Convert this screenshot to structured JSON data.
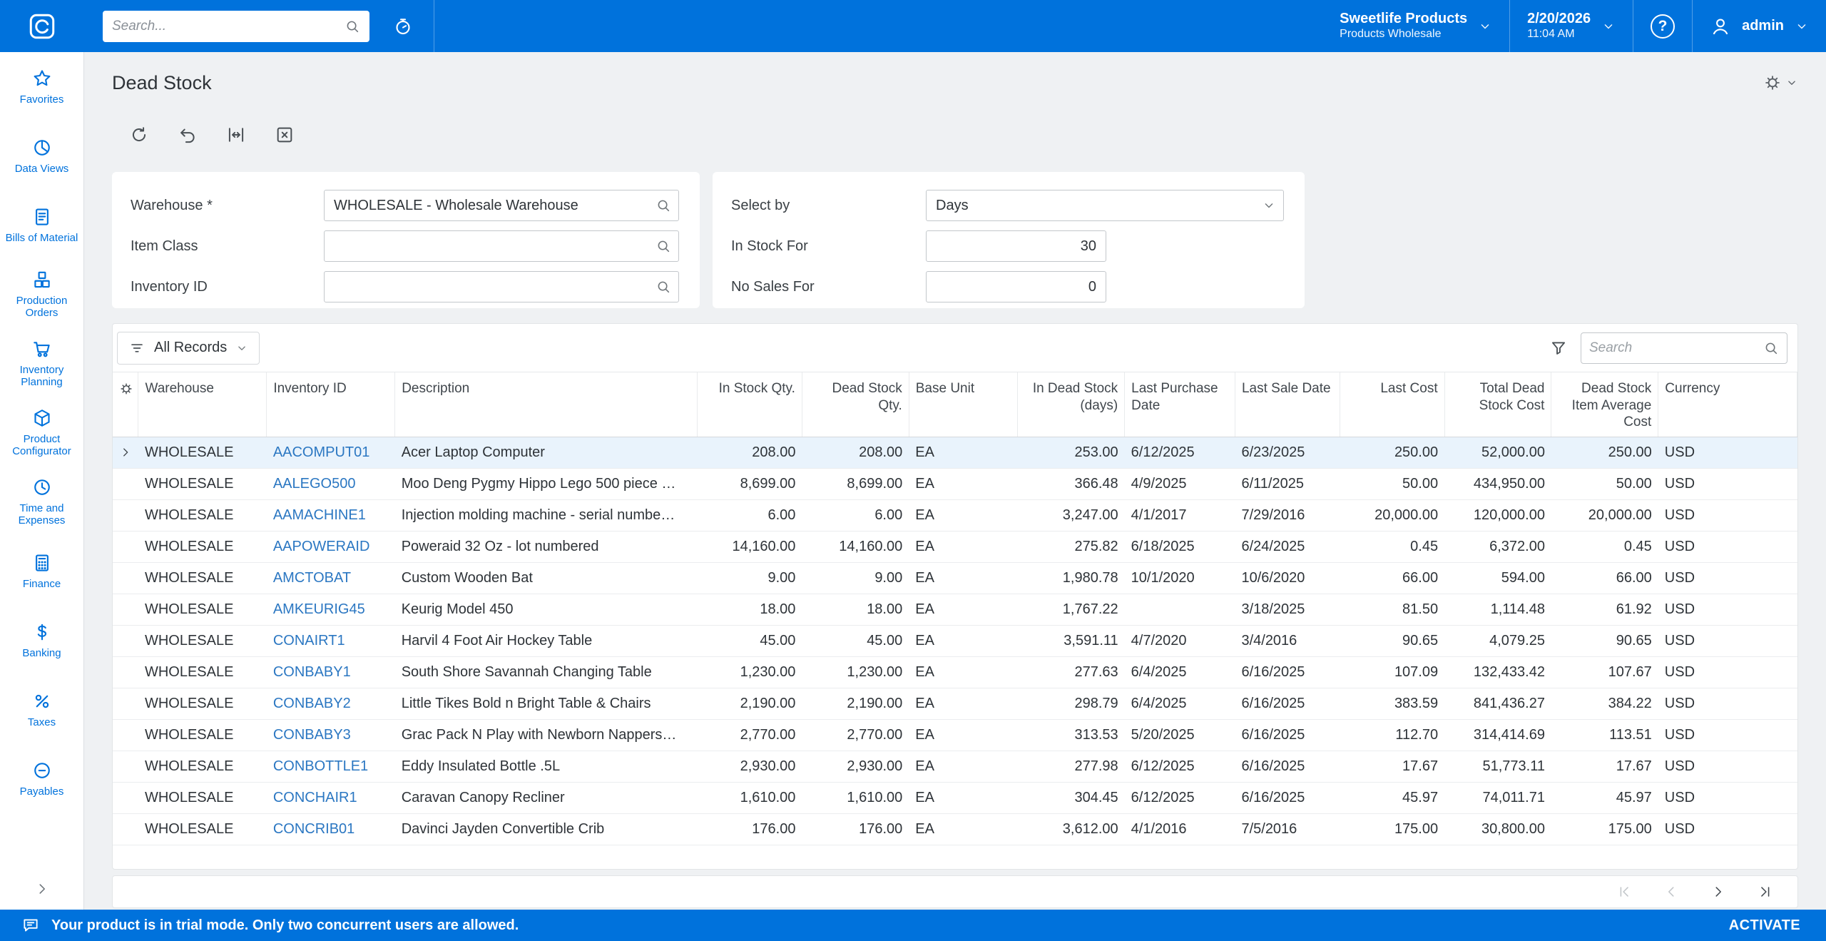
{
  "colors": {
    "bar_bg": "#0072DC",
    "accent": "#0072DC",
    "link": "#2B77C2",
    "selected_row_bg": "#E9F3FC"
  },
  "topbar": {
    "search_placeholder": "Search...",
    "tenant": {
      "name": "Sweetlife Products",
      "branch": "Products Wholesale"
    },
    "date": "2/20/2026",
    "time": "11:04 AM",
    "help_glyph": "?",
    "user": "admin"
  },
  "sidebar": {
    "items": [
      {
        "label": "Favorites",
        "icon": "star"
      },
      {
        "label": "Data Views",
        "icon": "pie"
      },
      {
        "label": "Bills of Material",
        "icon": "document"
      },
      {
        "label": "Production Orders",
        "icon": "boxes"
      },
      {
        "label": "Inventory Planning",
        "icon": "cart"
      },
      {
        "label": "Product Configurator",
        "icon": "cube"
      },
      {
        "label": "Time and Expenses",
        "icon": "clock"
      },
      {
        "label": "Finance",
        "icon": "calculator"
      },
      {
        "label": "Banking",
        "icon": "dollar"
      },
      {
        "label": "Taxes",
        "icon": "percent"
      },
      {
        "label": "Payables",
        "icon": "minus-circle"
      }
    ]
  },
  "page": {
    "title": "Dead Stock"
  },
  "filters": {
    "warehouse": {
      "label": "Warehouse *",
      "value": "WHOLESALE - Wholesale Warehouse"
    },
    "item_class": {
      "label": "Item Class",
      "value": ""
    },
    "inventory_id": {
      "label": "Inventory ID",
      "value": ""
    },
    "select_by": {
      "label": "Select by",
      "value": "Days"
    },
    "in_stock_for": {
      "label": "In Stock For",
      "value": "30"
    },
    "no_sales_for": {
      "label": "No Sales For",
      "value": "0"
    }
  },
  "grid_toolbar": {
    "filter_selector": "All Records",
    "search_placeholder": "Search"
  },
  "table": {
    "selected_row": 0,
    "columns": [
      "Warehouse",
      "Inventory ID",
      "Description",
      "In Stock Qty.",
      "Dead Stock Qty.",
      "Base Unit",
      "In Dead Stock (days)",
      "Last Purchase Date",
      "Last Sale Date",
      "Last Cost",
      "Total Dead Stock Cost",
      "Dead Stock Item Average Cost",
      "Currency"
    ],
    "rows": [
      {
        "warehouse": "WHOLESALE",
        "inventory_id": "AACOMPUT01",
        "description": "Acer Laptop Computer",
        "in_stock_qty": "208.00",
        "dead_stock_qty": "208.00",
        "base_unit": "EA",
        "in_dead_stock_days": "253.00",
        "last_purchase_date": "6/12/2025",
        "last_sale_date": "6/23/2025",
        "last_cost": "250.00",
        "total_dead_stock_cost": "52,000.00",
        "avg_cost": "250.00",
        "currency": "USD"
      },
      {
        "warehouse": "WHOLESALE",
        "inventory_id": "AALEGO500",
        "description": "Moo Deng Pygmy Hippo Lego 500 piece …",
        "in_stock_qty": "8,699.00",
        "dead_stock_qty": "8,699.00",
        "base_unit": "EA",
        "in_dead_stock_days": "366.48",
        "last_purchase_date": "4/9/2025",
        "last_sale_date": "6/11/2025",
        "last_cost": "50.00",
        "total_dead_stock_cost": "434,950.00",
        "avg_cost": "50.00",
        "currency": "USD"
      },
      {
        "warehouse": "WHOLESALE",
        "inventory_id": "AAMACHINE1",
        "description": "Injection molding machine - serial numbe…",
        "in_stock_qty": "6.00",
        "dead_stock_qty": "6.00",
        "base_unit": "EA",
        "in_dead_stock_days": "3,247.00",
        "last_purchase_date": "4/1/2017",
        "last_sale_date": "7/29/2016",
        "last_cost": "20,000.00",
        "total_dead_stock_cost": "120,000.00",
        "avg_cost": "20,000.00",
        "currency": "USD"
      },
      {
        "warehouse": "WHOLESALE",
        "inventory_id": "AAPOWERAID",
        "description": "Poweraid 32 Oz - lot numbered",
        "in_stock_qty": "14,160.00",
        "dead_stock_qty": "14,160.00",
        "base_unit": "EA",
        "in_dead_stock_days": "275.82",
        "last_purchase_date": "6/18/2025",
        "last_sale_date": "6/24/2025",
        "last_cost": "0.45",
        "total_dead_stock_cost": "6,372.00",
        "avg_cost": "0.45",
        "currency": "USD"
      },
      {
        "warehouse": "WHOLESALE",
        "inventory_id": "AMCTOBAT",
        "description": "Custom Wooden Bat",
        "in_stock_qty": "9.00",
        "dead_stock_qty": "9.00",
        "base_unit": "EA",
        "in_dead_stock_days": "1,980.78",
        "last_purchase_date": "10/1/2020",
        "last_sale_date": "10/6/2020",
        "last_cost": "66.00",
        "total_dead_stock_cost": "594.00",
        "avg_cost": "66.00",
        "currency": "USD"
      },
      {
        "warehouse": "WHOLESALE",
        "inventory_id": "AMKEURIG45",
        "description": "Keurig Model 450",
        "in_stock_qty": "18.00",
        "dead_stock_qty": "18.00",
        "base_unit": "EA",
        "in_dead_stock_days": "1,767.22",
        "last_purchase_date": "",
        "last_sale_date": "3/18/2025",
        "last_cost": "81.50",
        "total_dead_stock_cost": "1,114.48",
        "avg_cost": "61.92",
        "currency": "USD"
      },
      {
        "warehouse": "WHOLESALE",
        "inventory_id": "CONAIRT1",
        "description": "Harvil 4 Foot Air Hockey Table",
        "in_stock_qty": "45.00",
        "dead_stock_qty": "45.00",
        "base_unit": "EA",
        "in_dead_stock_days": "3,591.11",
        "last_purchase_date": "4/7/2020",
        "last_sale_date": "3/4/2016",
        "last_cost": "90.65",
        "total_dead_stock_cost": "4,079.25",
        "avg_cost": "90.65",
        "currency": "USD"
      },
      {
        "warehouse": "WHOLESALE",
        "inventory_id": "CONBABY1",
        "description": "South Shore Savannah Changing Table",
        "in_stock_qty": "1,230.00",
        "dead_stock_qty": "1,230.00",
        "base_unit": "EA",
        "in_dead_stock_days": "277.63",
        "last_purchase_date": "6/4/2025",
        "last_sale_date": "6/16/2025",
        "last_cost": "107.09",
        "total_dead_stock_cost": "132,433.42",
        "avg_cost": "107.67",
        "currency": "USD"
      },
      {
        "warehouse": "WHOLESALE",
        "inventory_id": "CONBABY2",
        "description": "Little Tikes Bold n Bright Table & Chairs",
        "in_stock_qty": "2,190.00",
        "dead_stock_qty": "2,190.00",
        "base_unit": "EA",
        "in_dead_stock_days": "298.79",
        "last_purchase_date": "6/4/2025",
        "last_sale_date": "6/16/2025",
        "last_cost": "383.59",
        "total_dead_stock_cost": "841,436.27",
        "avg_cost": "384.22",
        "currency": "USD"
      },
      {
        "warehouse": "WHOLESALE",
        "inventory_id": "CONBABY3",
        "description": "Grac Pack N Play with Newborn Nappers…",
        "in_stock_qty": "2,770.00",
        "dead_stock_qty": "2,770.00",
        "base_unit": "EA",
        "in_dead_stock_days": "313.53",
        "last_purchase_date": "5/20/2025",
        "last_sale_date": "6/16/2025",
        "last_cost": "112.70",
        "total_dead_stock_cost": "314,414.69",
        "avg_cost": "113.51",
        "currency": "USD"
      },
      {
        "warehouse": "WHOLESALE",
        "inventory_id": "CONBOTTLE1",
        "description": "Eddy Insulated Bottle .5L",
        "in_stock_qty": "2,930.00",
        "dead_stock_qty": "2,930.00",
        "base_unit": "EA",
        "in_dead_stock_days": "277.98",
        "last_purchase_date": "6/12/2025",
        "last_sale_date": "6/16/2025",
        "last_cost": "17.67",
        "total_dead_stock_cost": "51,773.11",
        "avg_cost": "17.67",
        "currency": "USD"
      },
      {
        "warehouse": "WHOLESALE",
        "inventory_id": "CONCHAIR1",
        "description": "Caravan Canopy Recliner",
        "in_stock_qty": "1,610.00",
        "dead_stock_qty": "1,610.00",
        "base_unit": "EA",
        "in_dead_stock_days": "304.45",
        "last_purchase_date": "6/12/2025",
        "last_sale_date": "6/16/2025",
        "last_cost": "45.97",
        "total_dead_stock_cost": "74,011.71",
        "avg_cost": "45.97",
        "currency": "USD"
      },
      {
        "warehouse": "WHOLESALE",
        "inventory_id": "CONCRIB01",
        "description": "Davinci Jayden Convertible Crib",
        "in_stock_qty": "176.00",
        "dead_stock_qty": "176.00",
        "base_unit": "EA",
        "in_dead_stock_days": "3,612.00",
        "last_purchase_date": "4/1/2016",
        "last_sale_date": "7/5/2016",
        "last_cost": "175.00",
        "total_dead_stock_cost": "30,800.00",
        "avg_cost": "175.00",
        "currency": "USD"
      }
    ]
  },
  "statusbar": {
    "message": "Your product is in trial mode. Only two concurrent users are allowed.",
    "action": "ACTIVATE"
  },
  "icons": {
    "page_toolbar": [
      "refresh",
      "undo",
      "fit-width",
      "export-to-excel"
    ],
    "grid": [
      "column-settings-gear",
      "funnel-filter",
      "search-magnifier"
    ],
    "pagination": [
      "first-page",
      "previous-page",
      "next-page",
      "last-page"
    ],
    "topbar": [
      "acumatica-logo",
      "search-magnifier",
      "stopwatch",
      "question-circle",
      "person",
      "chevron-down"
    ]
  }
}
